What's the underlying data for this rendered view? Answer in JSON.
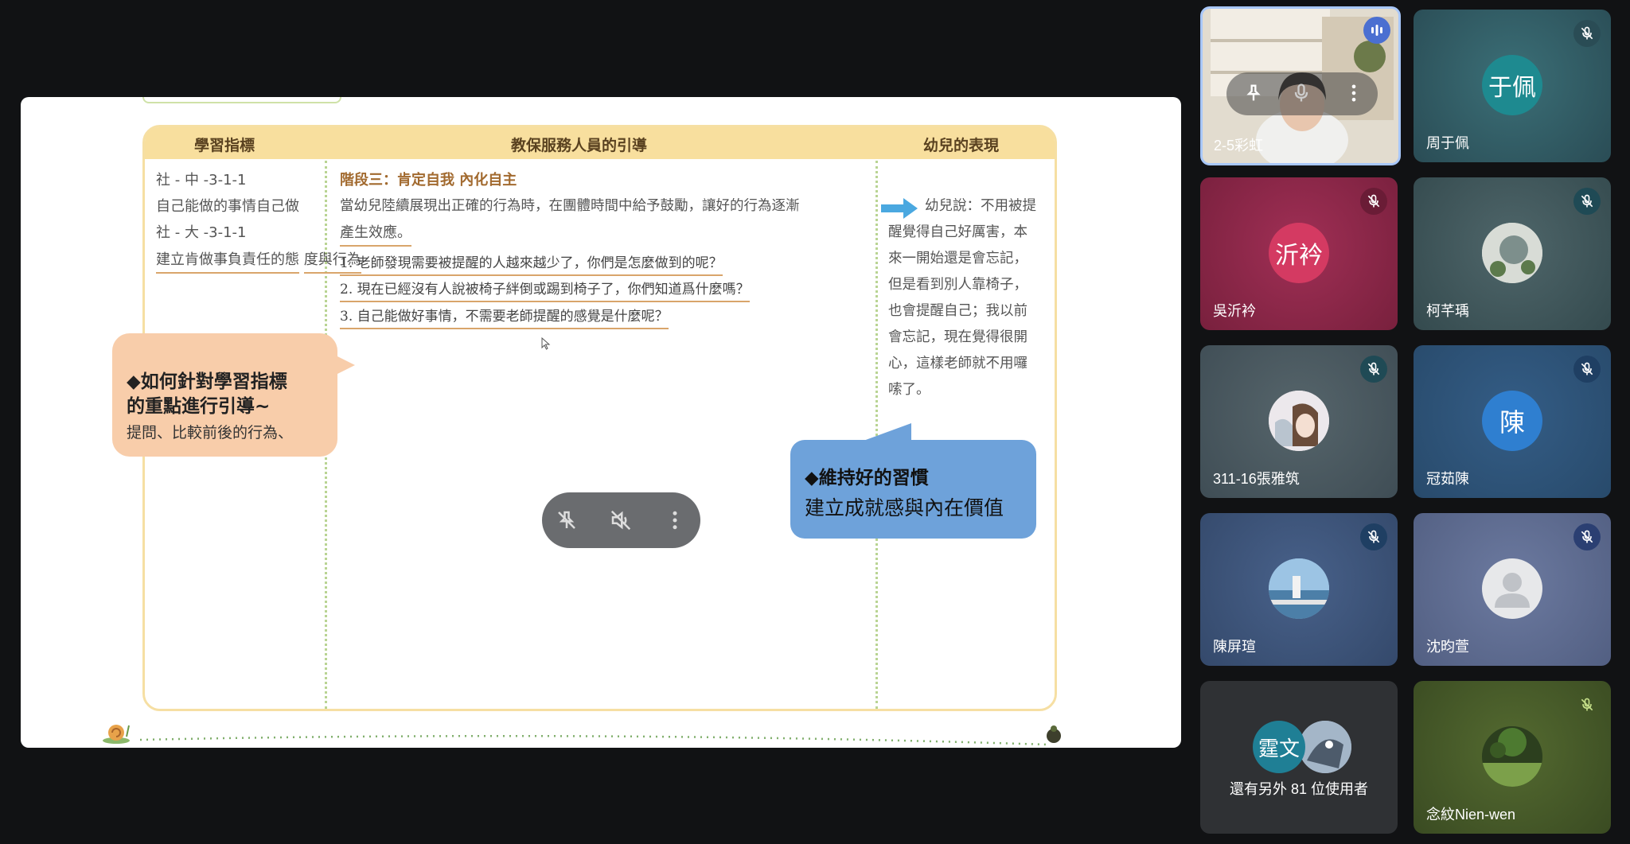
{
  "slide": {
    "headers": {
      "col1": "學習指標",
      "col2": "教保服務人員的引導",
      "col3": "幼兒的表現"
    },
    "col1": {
      "line1": "社 - 中 -3-1-1",
      "line2": "自己能做的事情自己做",
      "line3": "社 - 大 -3-1-1",
      "line4": "建立肯做事負責任的態",
      "line5": "度與行為"
    },
    "col2": {
      "stage": "階段三：肯定自我 內化自主",
      "intro1": "當幼兒陸續展現出正確的行為時，在團體時間中給予鼓勵，讓好的行為逐漸",
      "intro2": "產生效應。",
      "q1": "1. 老師發現需要被提醒的人越來越少了，你們是怎麼做到的呢？",
      "q2": "2. 現在已經沒有人說被椅子絆倒或踢到椅子了，你們知道爲什麼嗎？",
      "q3": "3. 自己能做好事情，不需要老師提醒的感覺是什麼呢？"
    },
    "col3": {
      "l1": "幼兒說：不用被提",
      "l2": "醒覺得自己好厲害，本",
      "l3": "來一開始還是會忘記，",
      "l4": "但是看到別人靠椅子，",
      "l5": "也會提醒自己；我以前",
      "l6": "會忘記，現在覺得很開",
      "l7": "心，這樣老師就不用囉",
      "l8": "嗦了。"
    },
    "bubble_left": {
      "title1": "◆如何針對學習指標",
      "title2": "的重點進行引導~",
      "sub": "提問、比較前後的行為、"
    },
    "bubble_right": {
      "title": "◆維持好的習慣",
      "sub": "建立成就感與內在價值"
    }
  },
  "controls": {
    "pill_icons": [
      "unpin-icon",
      "mute-speaker-icon",
      "more-vert-icon"
    ],
    "zoom_icons": [
      "zoom-in-icon",
      "open-in-new-icon",
      "fullscreen-icon"
    ]
  },
  "participants": [
    {
      "name": "2-5彩虹",
      "type": "video",
      "speaking": true
    },
    {
      "name": "周于佩",
      "avatar_text": "于佩",
      "avatar_color": "#1e8a90",
      "bg": "#2f5b63",
      "muted": true
    },
    {
      "name": "吳沂衿",
      "avatar_text": "沂衿",
      "avatar_color": "#d43a62",
      "bg": "#8d2647",
      "muted": true
    },
    {
      "name": "柯芊瑀",
      "avatar_text": "",
      "avatar_color": "#7a8d8a",
      "bg": "#3d5558",
      "muted": true
    },
    {
      "name": "311-16張雅筑",
      "avatar_text": "",
      "avatar_color": "#c9c3c9",
      "bg": "#4b5a63",
      "muted": true
    },
    {
      "name": "冠茹陳",
      "avatar_text": "陳",
      "avatar_color": "#2f7fd0",
      "bg": "#2e4f74",
      "muted": true
    },
    {
      "name": "陳屏瑄",
      "avatar_text": "",
      "avatar_color": "#7aa8c4",
      "bg": "#3e567a",
      "muted": true
    },
    {
      "name": "沈昀萱",
      "avatar_text": "",
      "avatar_color": "#e7e8ea",
      "bg": "#5e6b8e",
      "muted": true
    },
    {
      "name": "還有另外 81 位使用者",
      "avatar_text": "霆文",
      "avatar_color": "#1f7f95",
      "bg": "#2f3134",
      "overflow": true
    },
    {
      "name": "念紋Nien-wen",
      "avatar_text": "",
      "avatar_color": "#3d5a2a",
      "bg": "#4a5a2c",
      "muted": true
    }
  ]
}
